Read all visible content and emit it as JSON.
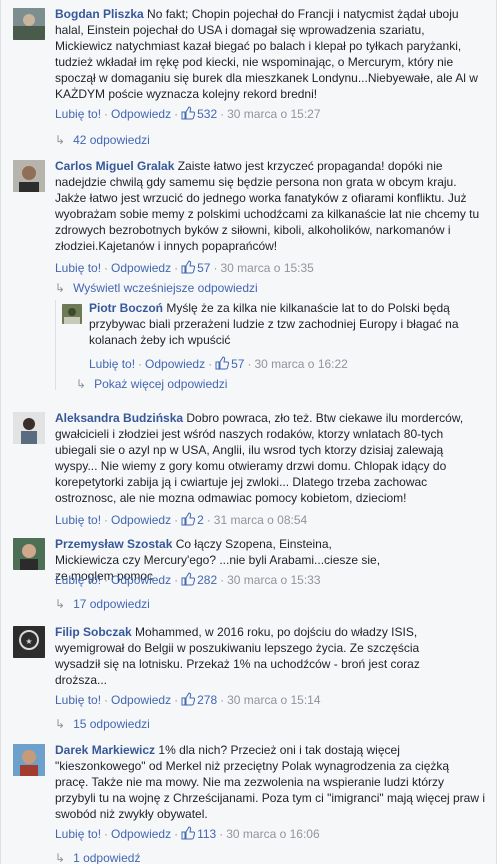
{
  "comments": [
    {
      "author": "Bogdan Pliszka",
      "text": "No fakt; Chopin pojechał do Francji i natycmist żądał uboju halal, Einstein pojechał do USA i domagał się wprowadzenia szariatu, Mickiewicz natychmiast kazał biegać po balach i klepał po tyłkach paryżanki, tudzież wkładał im rękę pod kiecki, nie wspominając, o Mercurym, który nie spoczął w domaganiu się burek dla mieszkanek Londynu...Niebyewałe, ale Al w KAŻDYM poście wyznacza kolejny rekord bredni!",
      "like": "Lubię to!",
      "reply": "Odpowiedz",
      "likes": "532",
      "time": "30 marca o 15:27",
      "replies_label": "42 odpowiedzi"
    },
    {
      "author": "Carlos Miguel Gralak",
      "text": "Zaiste łatwo jest krzyczeć propaganda! dopóki nie nadejdzie chwilą gdy samemu się będzie persona non grata w obcym kraju. Jakże łatwo jest wrzucić do jednego worka fanatyków z ofiarami konfliktu. Już wyobrażam sobie memy z polskimi uchodźcami za kilkanaście lat nie chcemy tu zdrowych bezrobotnych byków z siłowni, kiboli, alkoholików, narkomanów i złodziei.Kajetanów i innych popaprańców!",
      "like": "Lubię to!",
      "reply": "Odpowiedz",
      "likes": "57",
      "time": "30 marca o 15:35",
      "earlier_label": "Wyświetl wcześniejsze odpowiedzi",
      "nested": {
        "author": "Piotr Boczoń",
        "text": "Myślę że za kilka nie kilkanaście lat to do Polski będą przybywac biali przerażeni ludzie z tzw zachodniej Europy i błagać na kolanach żeby ich wpuścić",
        "like": "Lubię to!",
        "reply": "Odpowiedz",
        "likes": "57",
        "time": "30 marca o 16:22"
      },
      "more_label": "Pokaż więcej odpowiedzi"
    },
    {
      "author": "Aleksandra Budzińska",
      "text": "Dobro powraca, zło też. Btw ciekawe ilu morderców, gwałcicieli i złodziei jest wśród naszych rodaków, ktorzy wnlatach 80-tych ubiegali sie o azyl np w USA, Anglii, ilu wsrod tych ktorzy dzisiaj zalewają wyspy... Nie wiemy z gory komu otwieramy drzwi domu. Chlopak idący do korepetytorki zabija ją i cwiartuje jej zwloki... Dlatego trzeba zachowac ostroznosc, ale nie mozna odmawiac pomocy kobietom, dzieciom!",
      "like": "Lubię to!",
      "reply": "Odpowiedz",
      "likes": "2",
      "time": "31 marca o 08:54"
    },
    {
      "author": "Przemysław Szostak",
      "text": "Co łączy Szopena, Einsteina, Mickiewicza czy Mercury'ego? ...nie byli Arabami...ciesze sie, ze moglem pomoc",
      "like": "Lubię to!",
      "reply": "Odpowiedz",
      "likes": "282",
      "time": "30 marca o 15:33",
      "replies_label": "17 odpowiedzi"
    },
    {
      "author": "Filip Sobczak",
      "text": "Mohammed, w 2016 roku, po dojściu do władzy ISIS, wyemigrował do Belgii w poszukiwaniu lepszego życia. Ze szczęścia wysadził się na lotnisku. Przekaż 1% na uchodźców - broń jest coraz droższa...",
      "like": "Lubię to!",
      "reply": "Odpowiedz",
      "likes": "278",
      "time": "30 marca o 15:14",
      "replies_label": "15 odpowiedzi"
    },
    {
      "author": "Darek Markiewicz",
      "text": "1% dla nich? Przecież oni i tak dostają więcej \"kieszonkowego\" od Merkel niż przeciętny Polak wynagrodzenia za ciężką pracę. Także nie ma mowy. Nie ma zezwolenia na wspieranie ludzi którzy przybyli tu na wojnę z Chrześcijanami. Poza tym ci \"imigranci\" mają więcej praw i swobód niż zwykły obywatel.",
      "like": "Lubię to!",
      "reply": "Odpowiedz",
      "likes": "113",
      "time": "30 marca o 16:06",
      "replies_label": "1 odpowiedź"
    }
  ],
  "colors": {
    "link": "#365899",
    "action": "#4267b2",
    "meta": "#90949c",
    "background": "#f6f7f9"
  },
  "icons": {
    "like": "thumbs-up-icon",
    "reply_arrow": "reply-arrow-icon"
  }
}
